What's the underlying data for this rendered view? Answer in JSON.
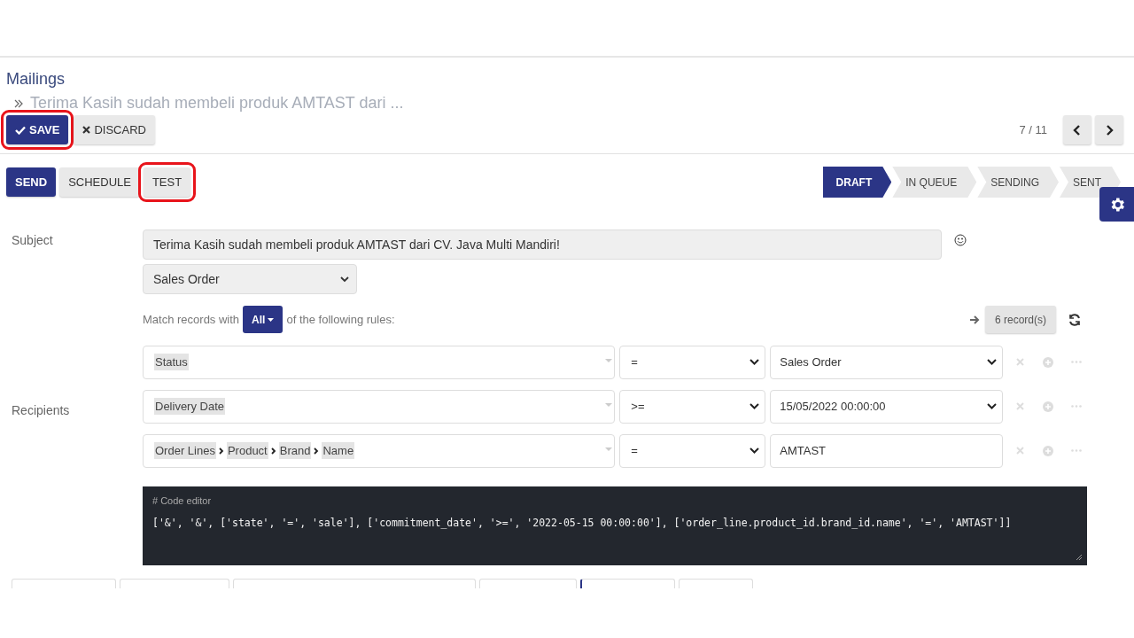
{
  "breadcrumb": {
    "parent": "Mailings",
    "current": "Terima Kasih sudah membeli produk AMTAST dari ..."
  },
  "actions": [
    {
      "kind": "save",
      "label": "SAVE",
      "highlighted": true
    },
    {
      "kind": "discard",
      "label": "DISCARD",
      "highlighted": false
    }
  ],
  "pager": {
    "value": "7 / 11"
  },
  "header_buttons": [
    {
      "kind": "primary",
      "label": "SEND",
      "highlighted": false
    },
    {
      "kind": "secondary",
      "label": "SCHEDULE",
      "highlighted": false
    },
    {
      "kind": "secondary",
      "label": "TEST",
      "highlighted": true
    }
  ],
  "status_steps": [
    {
      "label": "DRAFT",
      "selected": true
    },
    {
      "label": "IN QUEUE",
      "selected": false
    },
    {
      "label": "SENDING",
      "selected": false
    },
    {
      "label": "SENT",
      "selected": false
    }
  ],
  "subject": {
    "label": "Subject",
    "value": "Terima Kasih sudah membeli produk AMTAST dari CV. Java Multi Mandiri!"
  },
  "recipients": {
    "label": "Recipients",
    "model": "Sales Order",
    "match_before": "Match records with",
    "match_mode": "All",
    "match_after": "of the following rules:",
    "record_count": "6 record(s)",
    "rules": [
      {
        "path": [
          "Status"
        ],
        "operator": "=",
        "kind": "select",
        "value": "Sales Order"
      },
      {
        "path": [
          "Delivery Date"
        ],
        "operator": ">=",
        "kind": "select",
        "value": "15/05/2022 00:00:00"
      },
      {
        "path": [
          "Order Lines",
          "Product",
          "Brand",
          "Name"
        ],
        "operator": "=",
        "kind": "input",
        "value": "AMTAST"
      }
    ],
    "code_editor": {
      "label": "# Code editor",
      "code": "['&', '&', ['state', '=', 'sale'], ['commitment_date', '>=', '2022-05-15 00:00:00'], ['order_line.product_id.brand_id.name', '=', 'AMTAST']]"
    }
  }
}
